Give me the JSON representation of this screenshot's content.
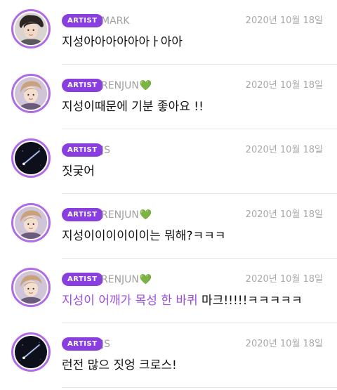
{
  "badge_label": "ARTIST",
  "heart_glyph": "💚",
  "colors": {
    "badge": "#8a3ee0",
    "avatar_ring": "#b06ce8",
    "highlight_text": "#9a4fe0",
    "heart": "#6fd44a",
    "meta_text": "#a0a0a0"
  },
  "messages": [
    {
      "author": "MARK",
      "heart": false,
      "avatar": "avatar-mark",
      "date": "2020년 10월 18일",
      "text": "지성아아아아아아ㅏ아아",
      "highlight": ""
    },
    {
      "author": "RENJUN",
      "heart": true,
      "avatar": "avatar-renjun",
      "date": "2020년 10월 18일",
      "text": "지성이때문에 기분 좋아요 !!",
      "highlight": ""
    },
    {
      "author": "JS",
      "heart": false,
      "avatar": "avatar-js",
      "date": "2020년 10월 18일",
      "text": "짓궂어",
      "highlight": ""
    },
    {
      "author": "RENJUN",
      "heart": true,
      "avatar": "avatar-renjun",
      "date": "2020년 10월 18일",
      "text": "지성이이이이이이는 뭐해?ㅋㅋㅋ",
      "highlight": ""
    },
    {
      "author": "RENJUN",
      "heart": true,
      "avatar": "avatar-renjun",
      "date": "2020년 10월 18일",
      "text": " 마크!!!!!ㅋㅋㅋㅋㅋ",
      "highlight": "지성이 어깨가 목성 한 바퀴"
    },
    {
      "author": "JS",
      "heart": false,
      "avatar": "avatar-js",
      "date": "2020년 10월 18일",
      "text": "런전 많으 짓엉 크로스!",
      "highlight": ""
    }
  ]
}
